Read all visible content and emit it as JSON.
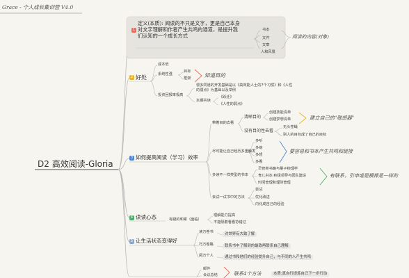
{
  "header": {
    "title": "Grace - 个人成长集训营 V4.0"
  },
  "center": {
    "title": "D2 高效阅读-Gloria"
  },
  "colors": {
    "red": "#e86b5b",
    "yellow": "#e7b52a",
    "blue": "#4f86d4",
    "green": "#49b06a",
    "purple": "#9c79c9",
    "gray_line": "#b8b8b8"
  },
  "branch1": {
    "badge": "1",
    "text_lines": [
      "定义(本质): 阅读的不只是文字，更是自己本身",
      "对文字理解和作者产生共鸣的通道，是提升我",
      "们认知的一个成长方式"
    ],
    "tags": [
      "书本",
      "文件",
      "文章",
      "人和风景"
    ],
    "note": "阅读的内容(对象)"
  },
  "branch2": {
    "badge": "2",
    "label": "好处",
    "items": {
      "cost": "成本低",
      "system": "系统性强",
      "goal": "目标",
      "framework": "框架",
      "know_goal": "知道目的",
      "investment": "投资回报率极高",
      "book_line1": "很多同道的开发基础是以《高效能人士的7个习惯》和《人性",
      "book_line2": "的弱点》为基础以及举例",
      "resonance": "本期共读",
      "resonance_1": "《跃迁》",
      "resonance_2": "《人性的弱点》"
    }
  },
  "branch3": {
    "badge": "3",
    "label": "如何提高阅读（学习）效率",
    "goal_group": {
      "label": "带着目的去看",
      "clear_goal": "清晰目的",
      "create_list": "创建技能清单",
      "create_dream": "创建梦想清单",
      "no_goal": "没有目的性去看",
      "no_restraint": "无头苍蝇",
      "reader_not_goal": "别人的目标成了自己的目标",
      "hand_note": "建立自己的\"敬感器\""
    },
    "learn_group": {
      "label": "尽可能让自己经历多重触发",
      "items": [
        "多听",
        "多练",
        "多想",
        "多看"
      ],
      "hand_note": "要容易和书本产生共鸣和链接"
    },
    "type_group": {
      "label": "多读不一样类型的书本",
      "items": [
        "灵修类书籍与量子物理学",
        "育儿书本·积极领导与团队建设",
        "时间管理和理财管理"
      ],
      "hand_note": "有联系，引申或是模棒是一样的"
    },
    "method_group": {
      "label": "去试一试书中的方法",
      "items": [
        "尝试",
        "优化改进",
        "内化成自己的经验"
      ]
    }
  },
  "branch4": {
    "badge": "4",
    "label": "读读心态",
    "sub": "有疑的和累（面临）",
    "items": [
      "理解能力提高",
      "不能隔着看看协错过"
    ]
  },
  "branch5": {
    "badge": "5",
    "label": "让生活状态变得好",
    "groups": [
      {
        "label": "读万卷书",
        "box": "对世界有大致了解"
      },
      {
        "label": "行万卷路",
        "box": "联系书中了解到的最政再联系自己理解"
      },
      {
        "label": "阅万个人",
        "box": "通过书和他们的经验提升自己，与不同的人产生共鸣"
      }
    ]
  },
  "branch6": {
    "badge": "6",
    "items": [
      "邮件",
      "会议总结"
    ],
    "hand_note": "联系4个方法",
    "box": "本质:真自行提炼自己下一步行动"
  }
}
